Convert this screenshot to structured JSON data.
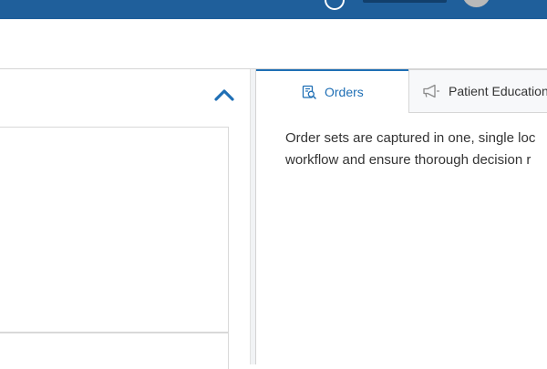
{
  "header": {
    "bar_color": "#1f5f9b",
    "icons": [
      "help-icon",
      "avatar"
    ]
  },
  "left_panel": {
    "collapse_icon": "chevron-up-icon"
  },
  "right_panel": {
    "tabs": [
      {
        "label": "Orders",
        "icon": "orders-search-icon",
        "active": true
      },
      {
        "label": "Patient Education",
        "icon": "megaphone-icon",
        "active": false
      }
    ],
    "description_lines": [
      "Order sets are captured in one, single loc",
      "workflow and ensure thorough decision r"
    ]
  },
  "colors": {
    "accent": "#1f6fb5",
    "border": "#d6d6d6"
  }
}
